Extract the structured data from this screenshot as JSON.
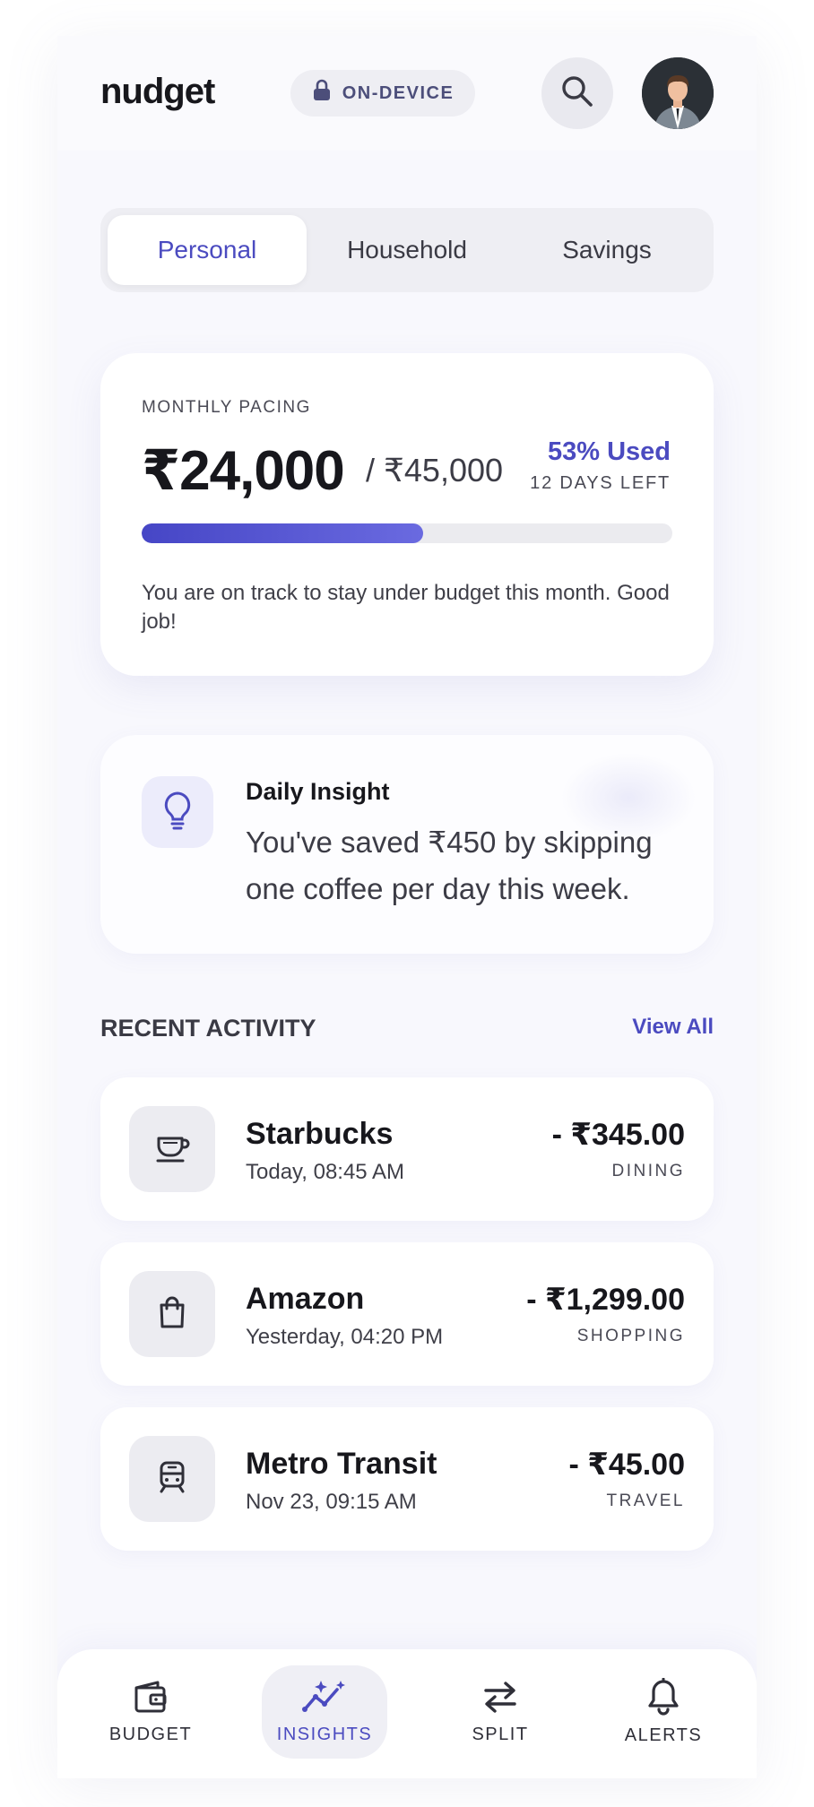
{
  "header": {
    "brand": "nudget",
    "badge": "ON-DEVICE"
  },
  "tabs": [
    {
      "label": "Personal",
      "active": true
    },
    {
      "label": "Household",
      "active": false
    },
    {
      "label": "Savings",
      "active": false
    }
  ],
  "pacing": {
    "label": "MONTHLY PACING",
    "spent": "₹24,000",
    "budget": "/ ₹45,000",
    "used": "53% Used",
    "days_left": "12 DAYS LEFT",
    "progress_fraction": 0.53,
    "message": "You are on track to stay under budget this month. Good job!"
  },
  "insight": {
    "title": "Daily Insight",
    "text": "You've saved ₹450 by skipping one coffee per day this week.",
    "icon": "lightbulb-icon"
  },
  "recent": {
    "title": "RECENT ACTIVITY",
    "view_all": "View All",
    "items": [
      {
        "merchant": "Starbucks",
        "when": "Today, 08:45 AM",
        "amount": "- ₹345.00",
        "category": "DINING",
        "icon": "coffee-cup-icon"
      },
      {
        "merchant": "Amazon",
        "when": "Yesterday, 04:20 PM",
        "amount": "- ₹1,299.00",
        "category": "SHOPPING",
        "icon": "shopping-bag-icon"
      },
      {
        "merchant": "Metro Transit",
        "when": "Nov 23, 09:15 AM",
        "amount": "- ₹45.00",
        "category": "TRAVEL",
        "icon": "train-icon"
      }
    ]
  },
  "nav": [
    {
      "label": "BUDGET",
      "icon": "wallet-icon",
      "active": false
    },
    {
      "label": "INSIGHTS",
      "icon": "sparkle-chart-icon",
      "active": true
    },
    {
      "label": "SPLIT",
      "icon": "swap-arrows-icon",
      "active": false
    },
    {
      "label": "ALERTS",
      "icon": "bell-icon",
      "active": false
    }
  ],
  "colors": {
    "accent": "#4b4bc0",
    "background": "#f8f8fd",
    "card": "#ffffff"
  }
}
